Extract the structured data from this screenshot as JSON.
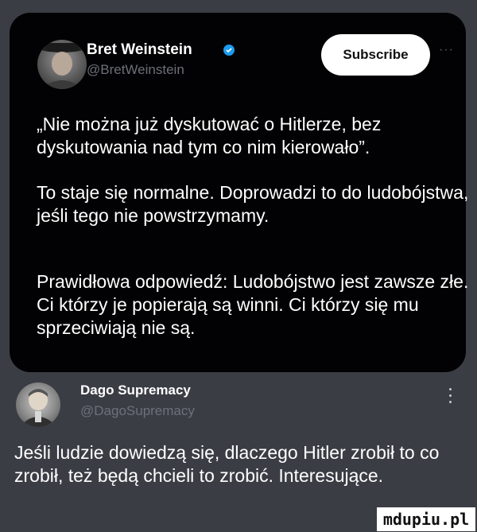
{
  "tweet": {
    "author_name": "Bret Weinstein",
    "author_handle": "@BretWeinstein",
    "verified": true,
    "subscribe_label": "Subscribe",
    "more_label": "···",
    "paragraphs": [
      "„Nie można już dyskutować o Hitlerze, bez dyskutowania nad tym co nim kierowało”.",
      "To staje się normalne. Doprowadzi to do ludobójstwa, jeśli tego nie powstrzymamy.",
      "Prawidłowa odpowiedź: Ludobójstwo jest zawsze złe. Ci którzy je popierają są winni. Ci którzy się mu sprzeciwiają nie są."
    ]
  },
  "reply": {
    "author_name": "Dago Supremacy",
    "author_handle": "@DagoSupremacy",
    "text": "Jeśli ludzie dowiedzą się, dlaczego Hitler zrobił to co zrobił, też będą chcieli to zrobić. Interesujące."
  },
  "watermark": {
    "text": "mdupiu.pl"
  },
  "colors": {
    "page_background": "#3b3d45",
    "card_background": "#020204",
    "verified_blue": "#1d9bf0",
    "handle_gray": "#6d7078"
  },
  "icons": {
    "verified": "verified-badge-icon",
    "more": "more-options-icon"
  }
}
